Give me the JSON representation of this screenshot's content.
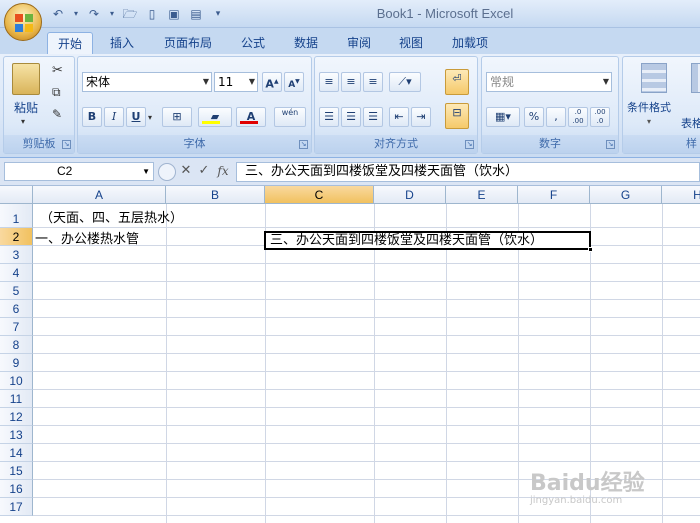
{
  "window": {
    "title": "Book1 - Microsoft Excel"
  },
  "qat": {
    "icons": [
      "undo-icon",
      "redo-icon",
      "open-icon",
      "new-icon",
      "save-icon",
      "print-preview-icon",
      "customize-icon"
    ]
  },
  "tabs": [
    {
      "label": "开始",
      "active": true
    },
    {
      "label": "插入"
    },
    {
      "label": "页面布局"
    },
    {
      "label": "公式"
    },
    {
      "label": "数据"
    },
    {
      "label": "审阅"
    },
    {
      "label": "视图"
    },
    {
      "label": "加载项"
    }
  ],
  "ribbon": {
    "clipboard": {
      "label": "剪贴板",
      "paste_label": "粘贴"
    },
    "font": {
      "label": "字体",
      "font_name": "宋体",
      "font_size": "11",
      "bold": "B",
      "italic": "I",
      "underline": "U",
      "grow": "A",
      "shrink": "A",
      "font_color": "A",
      "phonetic": "wén"
    },
    "alignment": {
      "label": "对齐方式"
    },
    "number": {
      "label": "数字",
      "format": "常规",
      "percent": "%",
      "comma": ",",
      "inc_decimal": ".0 .00",
      "dec_decimal": ".00 .0"
    },
    "styles": {
      "cond_format_label": "条件格式",
      "table_label": "表格",
      "label": "样"
    }
  },
  "formula_bar": {
    "name_box": "C2",
    "formula": "三、办公天面到四楼饭堂及四楼天面管（饮水）",
    "cancel": "✕",
    "enter": "✓",
    "fx": "fx"
  },
  "grid": {
    "columns": [
      "A",
      "B",
      "C",
      "D",
      "E",
      "F",
      "G",
      "H"
    ],
    "rows": [
      "1",
      "2",
      "3",
      "4",
      "5",
      "6",
      "7",
      "8",
      "9",
      "10",
      "11",
      "12",
      "13",
      "14",
      "15",
      "16",
      "17"
    ],
    "active_cell": "C2",
    "cells": {
      "A1": "（天面、四、五层热水）",
      "A2": "一、办公楼热水管",
      "C2": "三、办公天面到四楼饭堂及四楼天面管（饮水）"
    }
  },
  "watermark": {
    "text": "Baidu经验",
    "sub": "jingyan.baidu.com"
  }
}
